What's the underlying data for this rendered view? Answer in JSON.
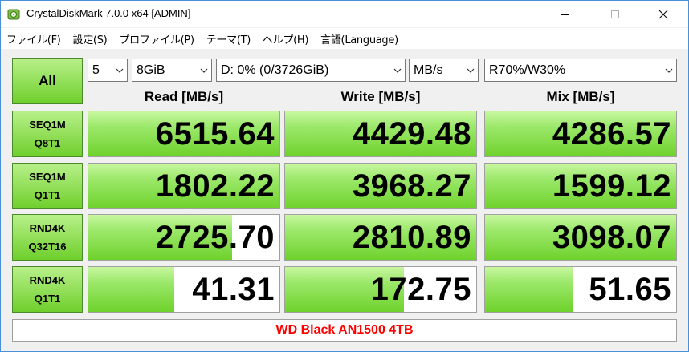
{
  "window": {
    "title": "CrystalDiskMark 7.0.0 x64 [ADMIN]",
    "minimize": "–",
    "maximize": "☐",
    "close": "✕"
  },
  "menu": [
    "ファイル(F)",
    "設定(S)",
    "プロファイル(P)",
    "テーマ(T)",
    "ヘルプ(H)",
    "言語(Language)"
  ],
  "controls": {
    "all_label": "All",
    "count": "5",
    "size": "8GiB",
    "drive": "D: 0% (0/3726GiB)",
    "unit": "MB/s",
    "mix": "R70%/W30%"
  },
  "headers": {
    "read": "Read [MB/s]",
    "write": "Write [MB/s]",
    "mix": "Mix [MB/s]"
  },
  "rows": [
    {
      "line1": "SEQ1M",
      "line2": "Q8T1",
      "read": "6515.64",
      "write": "4429.48",
      "mix": "4286.57",
      "read_fill": 1.0,
      "write_fill": 1.0,
      "mix_fill": 1.0
    },
    {
      "line1": "SEQ1M",
      "line2": "Q1T1",
      "read": "1802.22",
      "write": "3968.27",
      "mix": "1599.12",
      "read_fill": 1.0,
      "write_fill": 1.0,
      "mix_fill": 1.0
    },
    {
      "line1": "RND4K",
      "line2": "Q32T16",
      "read": "2725.70",
      "write": "2810.89",
      "mix": "3098.07",
      "read_fill": 0.75,
      "write_fill": 1.0,
      "mix_fill": 1.0
    },
    {
      "line1": "RND4K",
      "line2": "Q1T1",
      "read": "41.31",
      "write": "172.75",
      "mix": "51.65",
      "read_fill": 0.45,
      "write_fill": 0.62,
      "mix_fill": 0.46
    }
  ],
  "comment": "WD Black AN1500 4TB",
  "colors": {
    "accent_green": "#6fcf2c",
    "comment_red": "#ff0000",
    "window_border": "#4a90d9"
  },
  "icons": {
    "app": "disk-icon",
    "dropdown": "chevron-down-icon"
  }
}
